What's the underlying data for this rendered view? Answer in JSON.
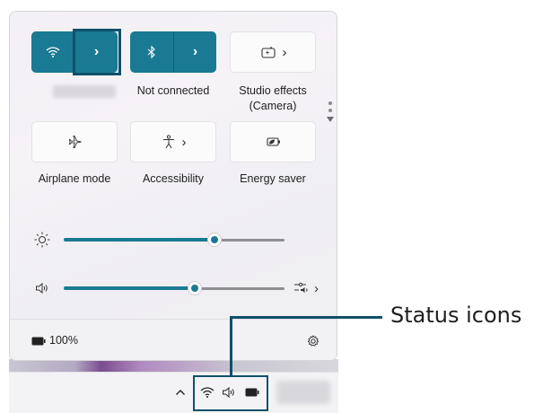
{
  "quick_settings": {
    "tiles": {
      "wifi": {
        "label": "",
        "icon": "wifi-icon",
        "state": "on"
      },
      "bluetooth": {
        "label": "Not connected",
        "icon": "bluetooth-icon",
        "state": "on"
      },
      "studio_effects": {
        "label_line1": "Studio effects",
        "label_line2": "(Camera)",
        "icon": "camera-effects-icon",
        "state": "off"
      },
      "airplane": {
        "label": "Airplane mode",
        "icon": "airplane-icon",
        "state": "off"
      },
      "accessibility": {
        "label": "Accessibility",
        "icon": "accessibility-icon",
        "state": "off"
      },
      "energy_saver": {
        "label": "Energy saver",
        "icon": "energy-saver-icon",
        "state": "off"
      }
    },
    "brightness": {
      "icon": "brightness-icon",
      "level": 0.7
    },
    "volume": {
      "icon": "speaker-icon",
      "level": 0.58
    },
    "footer": {
      "battery": "100%",
      "battery_icon": "battery-icon",
      "settings_icon": "gear-icon"
    }
  },
  "taskbar": {
    "tray_icons": [
      "chevron-up-icon",
      "wifi-icon",
      "speaker-icon",
      "battery-icon"
    ]
  },
  "callout": {
    "text": "Status icons"
  },
  "colors": {
    "accent": "#1a7a93",
    "highlight": "#10506a"
  }
}
